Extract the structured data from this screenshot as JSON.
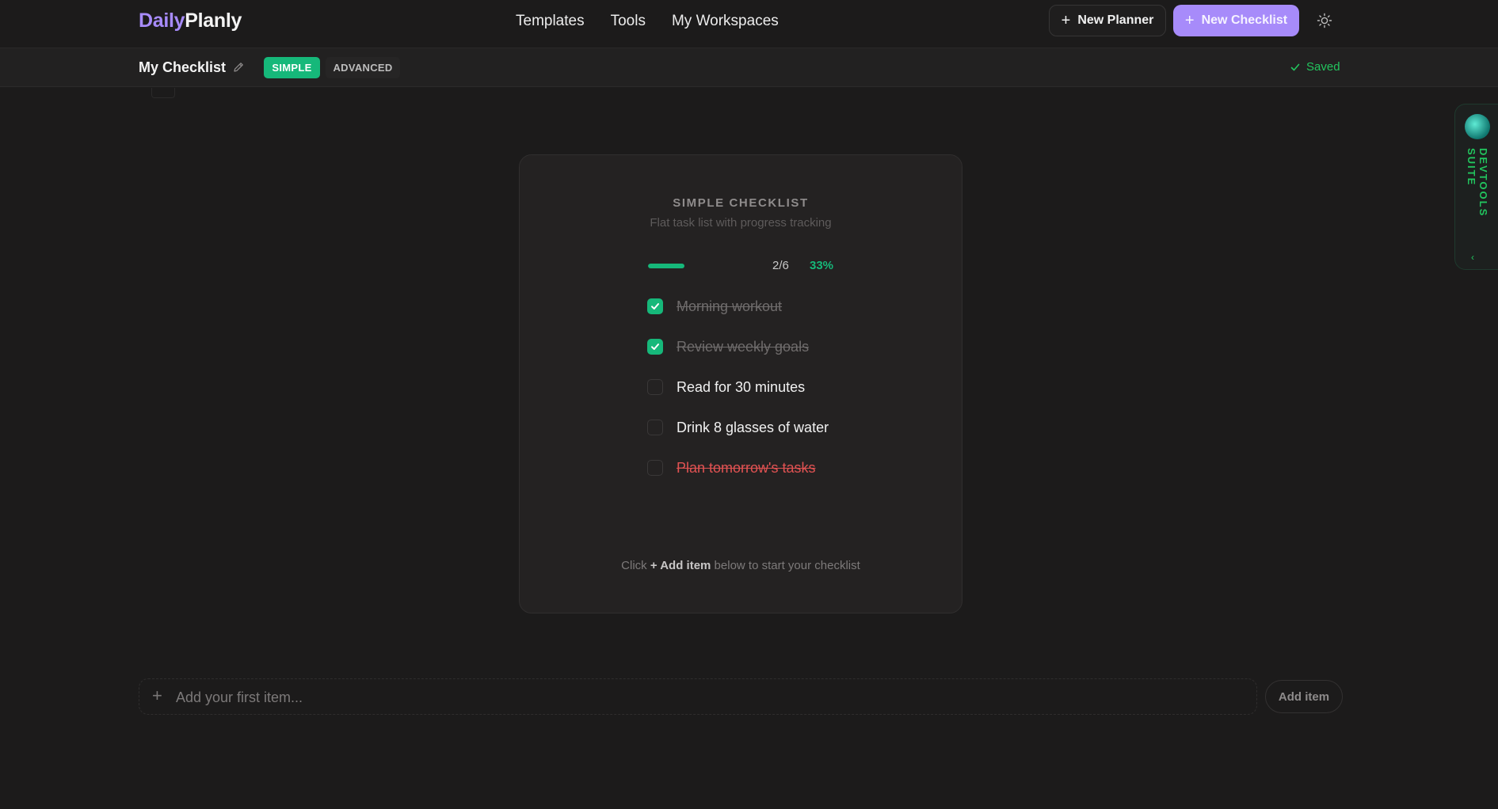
{
  "header": {
    "brand_part1": "Daily",
    "brand_part2": "Planly",
    "nav": [
      "Templates",
      "Tools",
      "My Workspaces"
    ],
    "new_planner_label": "New Planner",
    "new_checklist_label": "New Checklist",
    "theme_icon": "sun-icon"
  },
  "subheader": {
    "title": "My Checklist",
    "edit_icon": "pencil-icon",
    "mode_simple": "SIMPLE",
    "mode_advanced": "ADVANCED",
    "active_mode": "SIMPLE",
    "saved_label": "Saved"
  },
  "card": {
    "title": "SIMPLE CHECKLIST",
    "subtitle": "Flat task list with progress tracking",
    "progress": {
      "count": "2/6",
      "percent": "33%",
      "fraction": 0.33
    },
    "items": [
      {
        "label": "Morning workout",
        "checked": true,
        "state": "done"
      },
      {
        "label": "Review weekly goals",
        "checked": true,
        "state": "done"
      },
      {
        "label": "Read for 30 minutes",
        "checked": false,
        "state": "open"
      },
      {
        "label": "Drink 8 glasses of water",
        "checked": false,
        "state": "open"
      },
      {
        "label": "Plan tomorrow's tasks",
        "checked": false,
        "state": "danger"
      }
    ],
    "hint_prefix": "Click ",
    "hint_bold": "+ Add item",
    "hint_suffix": " below to start your checklist"
  },
  "add_item": {
    "placeholder": "Add your first item...",
    "button_label": "Add item"
  },
  "devtools": {
    "label": "DEVTOOLS SUITE"
  },
  "colors": {
    "accent_purple": "#a78bfa",
    "accent_green": "#16b87a",
    "danger_red": "#e05252",
    "background": "#1c1b1b"
  }
}
